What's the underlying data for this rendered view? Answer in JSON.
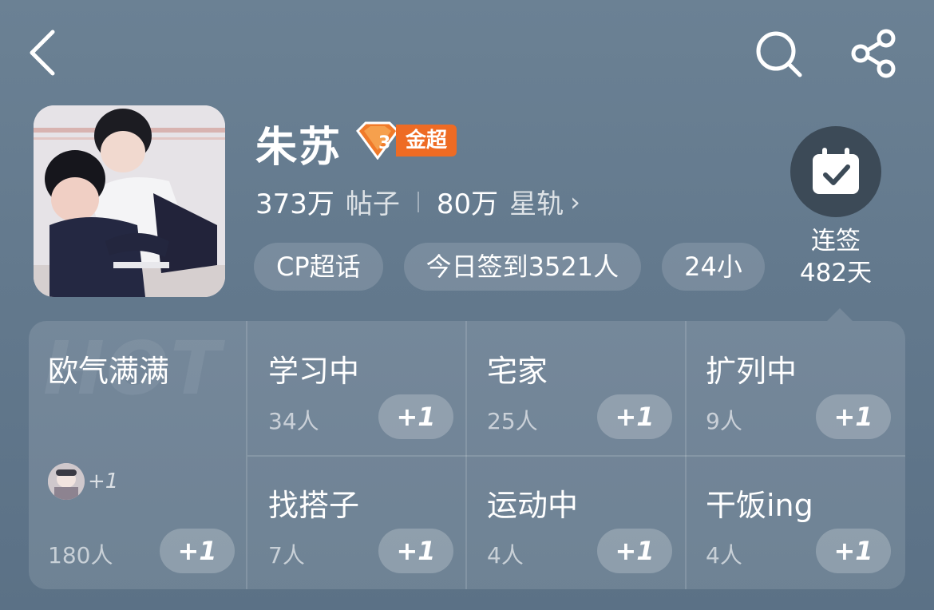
{
  "header": {
    "back_icon": "chevron-left-icon",
    "search_icon": "search-icon",
    "share_icon": "share-icon"
  },
  "profile": {
    "name": "朱苏",
    "badge_label": "金超",
    "badge_level": "3",
    "badge_color": "#ee6b24",
    "posts_count": "373万",
    "posts_label": "帖子",
    "orbit_count": "80万",
    "orbit_label": "星轨",
    "orbit_chevron": "›"
  },
  "tags": [
    "CP超话",
    "今日签到3521人",
    "24小"
  ],
  "checkin": {
    "icon": "calendar-check-icon",
    "line1": "连签",
    "line2": "482天"
  },
  "mood_panel": {
    "hot_watermark": "HOT",
    "featured": {
      "title": "欧气满满",
      "mini_plus": "+1",
      "count": "180人",
      "button": "+1"
    },
    "cells": [
      {
        "title": "学习中",
        "count": "34人",
        "button": "+1"
      },
      {
        "title": "宅家",
        "count": "25人",
        "button": "+1"
      },
      {
        "title": "扩列中",
        "count": "9人",
        "button": "+1"
      },
      {
        "title": "找搭子",
        "count": "7人",
        "button": "+1"
      },
      {
        "title": "运动中",
        "count": "4人",
        "button": "+1"
      },
      {
        "title": "干饭ing",
        "count": "4人",
        "button": "+1"
      }
    ]
  }
}
